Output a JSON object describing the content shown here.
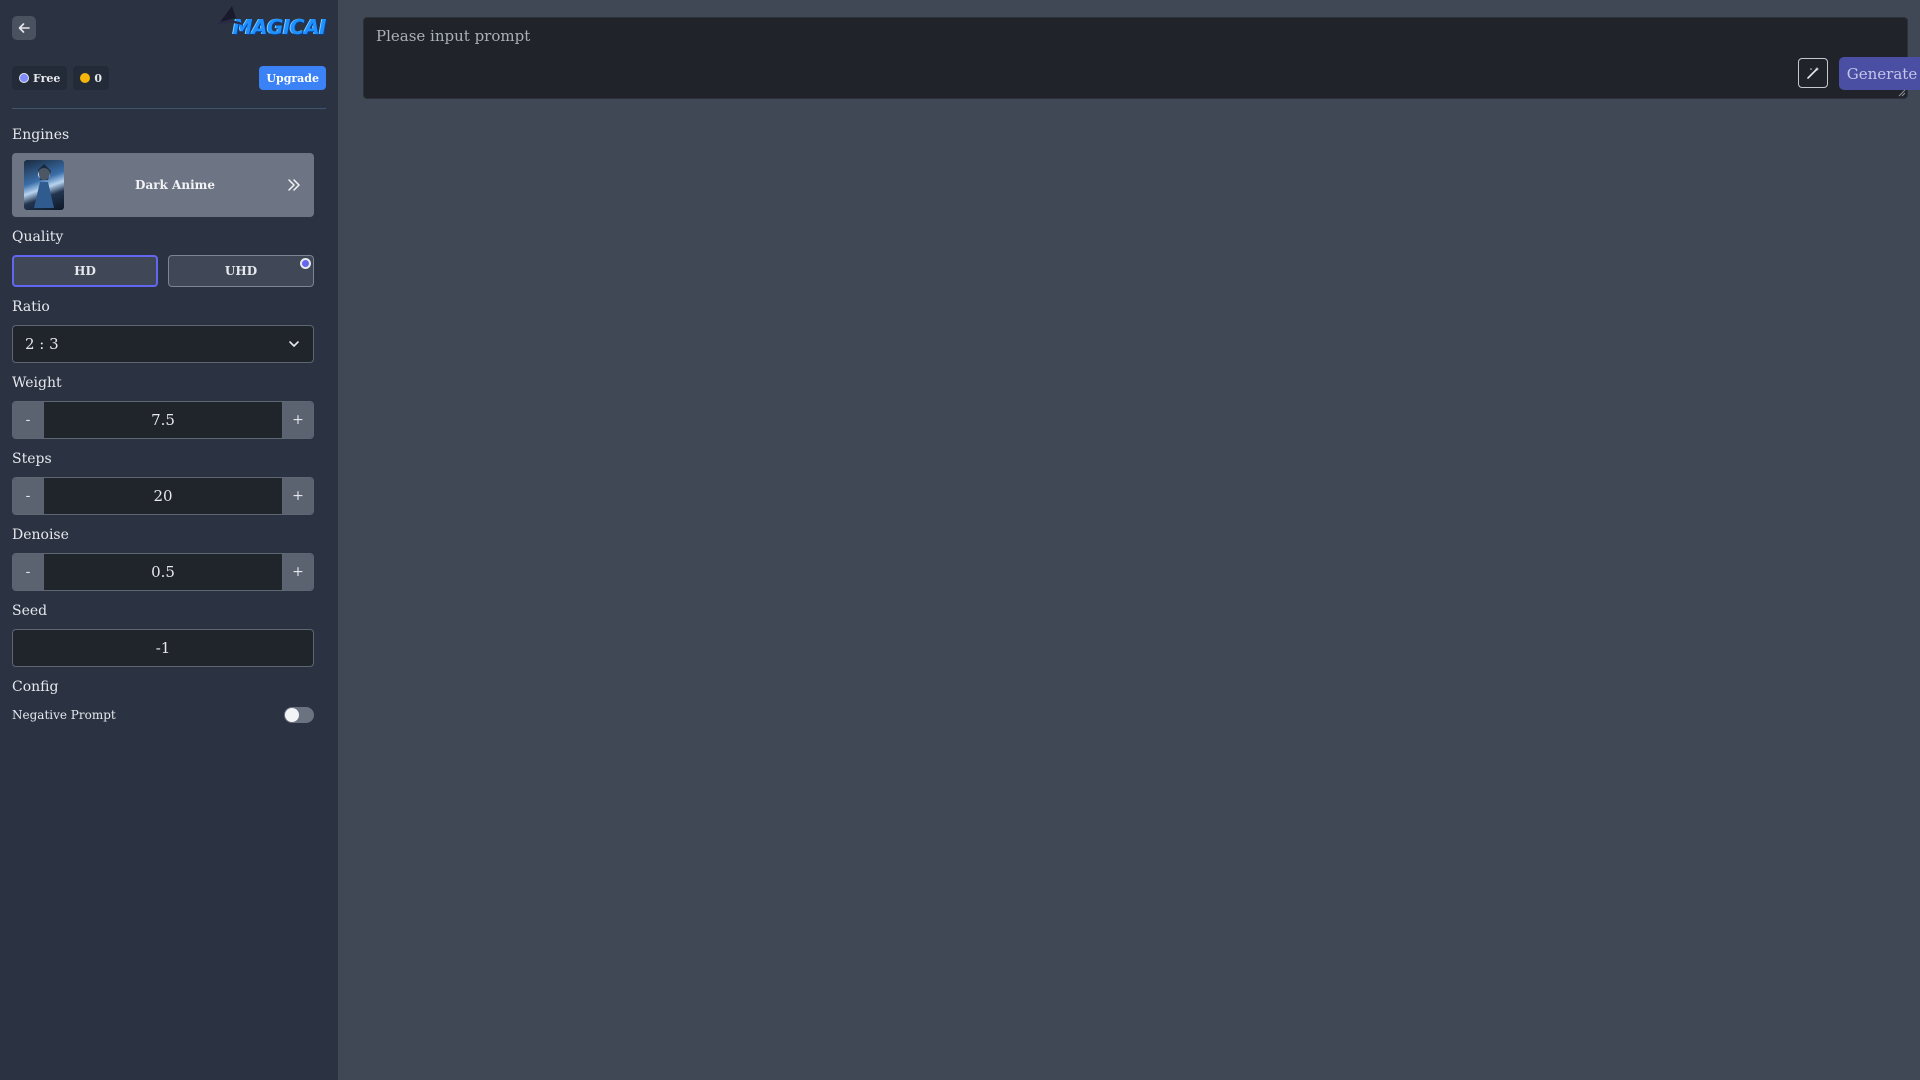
{
  "app": {
    "logo_text": "MAGICAI"
  },
  "account": {
    "plan_label": "Free",
    "credits": "0",
    "upgrade_label": "Upgrade"
  },
  "engines": {
    "label": "Engines",
    "selected": "Dark Anime"
  },
  "quality": {
    "label": "Quality",
    "options": [
      "HD",
      "UHD"
    ],
    "selected": "HD"
  },
  "ratio": {
    "label": "Ratio",
    "value": "2 : 3"
  },
  "weight": {
    "label": "Weight",
    "value": "7.5",
    "minus": "-",
    "plus": "+"
  },
  "steps": {
    "label": "Steps",
    "value": "20",
    "minus": "-",
    "plus": "+"
  },
  "denoise": {
    "label": "Denoise",
    "value": "0.5",
    "minus": "-",
    "plus": "+"
  },
  "seed": {
    "label": "Seed",
    "value": "-1"
  },
  "config": {
    "label": "Config",
    "negative_prompt_label": "Negative Prompt",
    "negative_prompt_enabled": false
  },
  "prompt": {
    "placeholder": "Please input prompt",
    "generate_label": "Generate"
  },
  "colors": {
    "sidebar_bg": "#2b3343",
    "main_bg": "#3f4854",
    "accent": "#6366f1",
    "upgrade": "#3b82f6",
    "generate": "#4a4fa3",
    "free_dot": "#818cf8",
    "coin_dot": "#f5b50a"
  }
}
